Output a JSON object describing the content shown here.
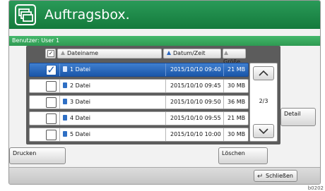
{
  "window": {
    "title": "Auftragsbox."
  },
  "user": {
    "label": "Benutzer: User 1"
  },
  "table": {
    "headers": {
      "name": "Dateiname",
      "date": "Datum/Zeit",
      "size": "Größe"
    },
    "rows": [
      {
        "name": "1 Datei",
        "date": "2015/10/10 09:40",
        "size": "21 MB",
        "checked": true,
        "selected": true
      },
      {
        "name": "2 Datei",
        "date": "2015/10/10 09:45",
        "size": "30 MB",
        "checked": false,
        "selected": false
      },
      {
        "name": "3 Datei",
        "date": "2015/10/10 09:50",
        "size": "36 MB",
        "checked": false,
        "selected": false
      },
      {
        "name": "4 Datei",
        "date": "2015/10/10 09:55",
        "size": "21 MB",
        "checked": false,
        "selected": false
      },
      {
        "name": "5 Datei",
        "date": "2015/10/10 10:00",
        "size": "30 MB",
        "checked": false,
        "selected": false
      }
    ]
  },
  "pager": {
    "indicator": "2/3"
  },
  "buttons": {
    "detail": "Detail",
    "print": "Drucken",
    "delete": "Löschen",
    "close": "Schließen"
  },
  "figure_ref": "b0202",
  "colors": {
    "titlebar": "#1f8a4c",
    "userbar": "#3aa862",
    "selection": "#2a6ac0"
  }
}
